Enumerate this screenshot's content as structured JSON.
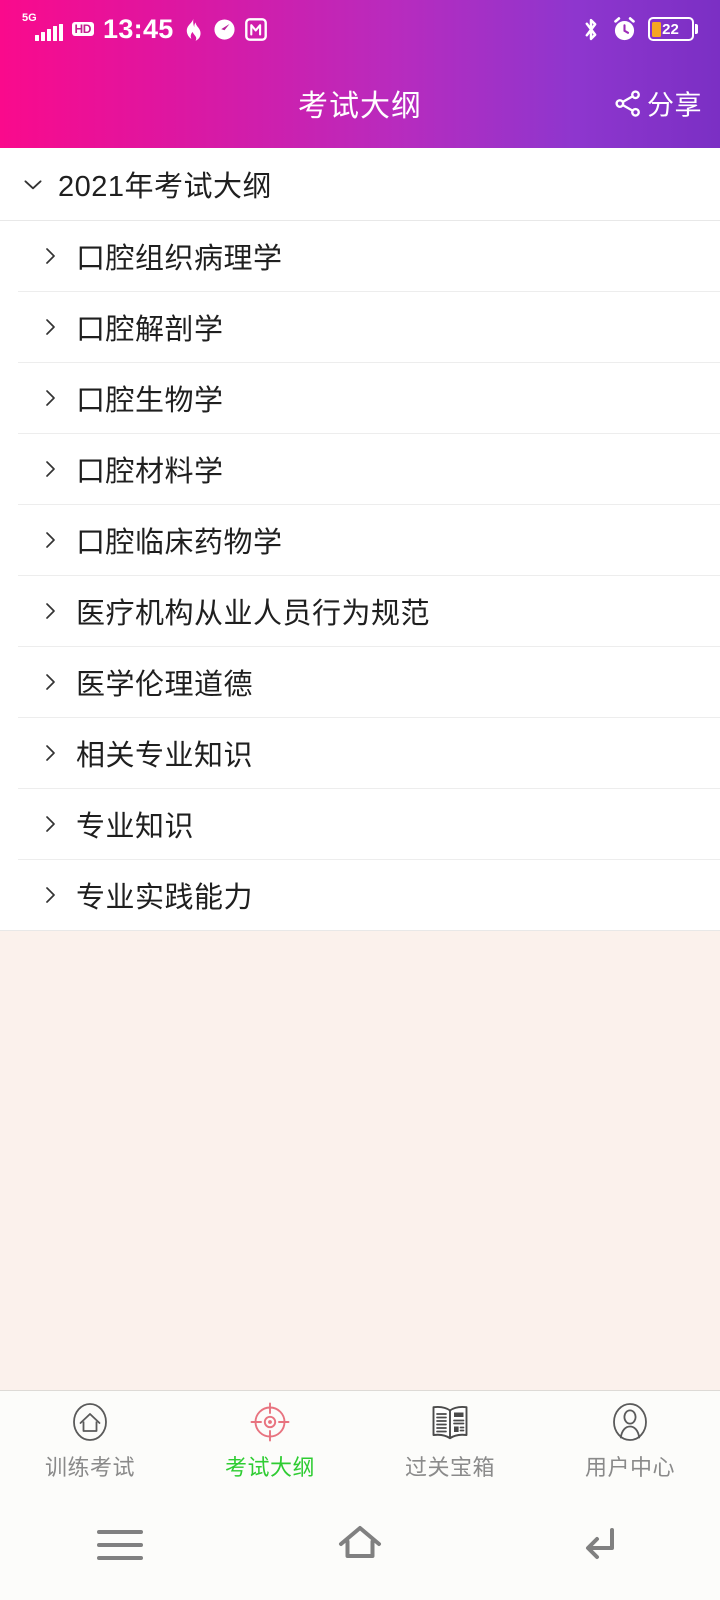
{
  "status_bar": {
    "network_label": "5G",
    "hd_label": "HD",
    "time": "13:45",
    "icons_left": [
      "signal-bars-icon",
      "hd-icon",
      "flame-icon",
      "speedometer-icon",
      "m-app-icon"
    ],
    "icons_right": [
      "bluetooth-icon",
      "alarm-clock-icon"
    ],
    "battery_percent": "22"
  },
  "header": {
    "title": "考试大纲",
    "share_label": "分享",
    "share_icon": "share-icon",
    "gradient_start": "#FA0A8C",
    "gradient_end": "#7B2FC4"
  },
  "outline": {
    "parent": {
      "label": "2021年考试大纲",
      "expanded": true,
      "icon": "chevron-down-icon"
    },
    "items": [
      {
        "label": "口腔组织病理学",
        "icon": "chevron-right-icon"
      },
      {
        "label": "口腔解剖学",
        "icon": "chevron-right-icon"
      },
      {
        "label": "口腔生物学",
        "icon": "chevron-right-icon"
      },
      {
        "label": "口腔材料学",
        "icon": "chevron-right-icon"
      },
      {
        "label": "口腔临床药物学",
        "icon": "chevron-right-icon"
      },
      {
        "label": "医疗机构从业人员行为规范",
        "icon": "chevron-right-icon"
      },
      {
        "label": "医学伦理道德",
        "icon": "chevron-right-icon"
      },
      {
        "label": "相关专业知识",
        "icon": "chevron-right-icon"
      },
      {
        "label": "专业知识",
        "icon": "chevron-right-icon"
      },
      {
        "label": "专业实践能力",
        "icon": "chevron-right-icon"
      }
    ]
  },
  "tab_bar": {
    "active_color": "#2ECC32",
    "active_icon_color": "#E8737F",
    "inactive_color": "#8A8A8A",
    "tabs": [
      {
        "label": "训练考试",
        "icon": "home-icon",
        "active": false
      },
      {
        "label": "考试大纲",
        "icon": "target-icon",
        "active": true
      },
      {
        "label": "过关宝箱",
        "icon": "newspaper-icon",
        "active": false
      },
      {
        "label": "用户中心",
        "icon": "user-icon",
        "active": false
      }
    ]
  },
  "system_nav": {
    "buttons": [
      {
        "icon": "recents-menu-icon"
      },
      {
        "icon": "home-outline-icon"
      },
      {
        "icon": "back-arrow-icon"
      }
    ]
  },
  "colors": {
    "page_background": "#FBF1EC",
    "list_background": "#FFFFFF",
    "divider": "#EDEDED",
    "battery_fill": "#F5A623"
  }
}
